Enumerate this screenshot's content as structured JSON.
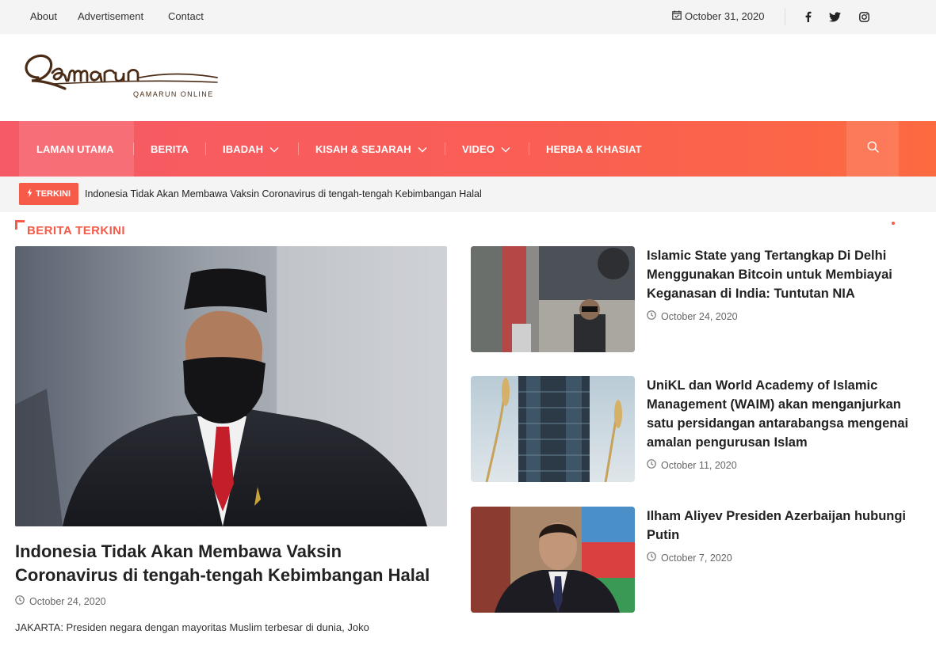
{
  "topbar": {
    "links": [
      "About",
      "Advertisement",
      "Contact"
    ],
    "date": "October 31, 2020",
    "social_icons": [
      "facebook-icon",
      "twitter-icon",
      "instagram-icon"
    ]
  },
  "logo": {
    "script_text": "Qamarun",
    "tagline": "QAMARUN ONLINE"
  },
  "nav": {
    "items": [
      "LAMAN UTAMA",
      "BERITA",
      "IBADAH",
      "KISAH & SEJARAH",
      "VIDEO",
      "HERBA & KHASIAT"
    ],
    "search_icon": "search-icon"
  },
  "ticker": {
    "label": "TERKINI",
    "headline": "Indonesia Tidak Akan Membawa Vaksin Coronavirus di tengah-tengah Kebimbangan Halal"
  },
  "section": {
    "title": "BERITA TERKINI"
  },
  "featured": {
    "title": "Indonesia Tidak Akan Membawa Vaksin Coronavirus di tengah-tengah Kebimbangan Halal",
    "date": "October 24, 2020",
    "excerpt": "JAKARTA: Presiden negara dengan mayoritas Muslim terbesar di dunia, Joko"
  },
  "articles": [
    {
      "title": "Islamic State yang Tertangkap Di Delhi Menggunakan Bitcoin untuk Membiayai Keganasan di India: Tuntutan NIA",
      "date": "October 24, 2020"
    },
    {
      "title": "UniKL dan World Academy of Islamic Management (WAIM) akan menganjurkan satu persidangan antarabangsa mengenai amalan pengurusan Islam",
      "date": "October 11, 2020"
    },
    {
      "title": "Ilham Aliyev Presiden Azerbaijan hubungi Putin",
      "date": "October 7, 2020"
    }
  ],
  "colors": {
    "accent": "#f65a48",
    "nav_start": "#f65a67",
    "nav_end": "#fc6a40"
  }
}
